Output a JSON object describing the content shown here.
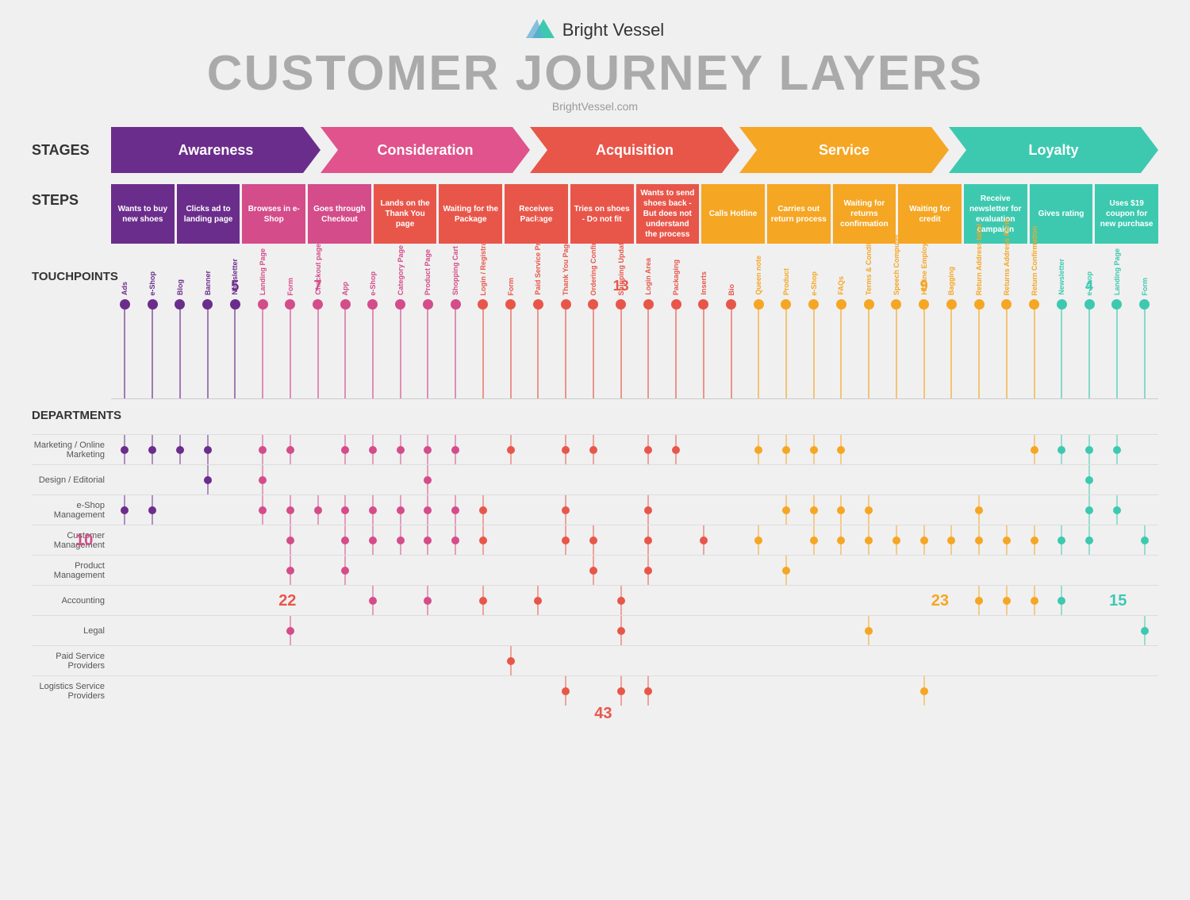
{
  "header": {
    "logo_text": "Bright Vessel",
    "title": "CUSTOMER JOURNEY LAYERS",
    "subtitle": "BrightVessel.com"
  },
  "stages_label": "STAGES",
  "stages": [
    {
      "label": "Awareness",
      "color": "#6b2d8b"
    },
    {
      "label": "Consideration",
      "color": "#e0538c"
    },
    {
      "label": "Acquisition",
      "color": "#e8564a"
    },
    {
      "label": "Service",
      "color": "#f5a623"
    },
    {
      "label": "Loyalty",
      "color": "#3dc9b0"
    }
  ],
  "steps_label": "STEPS",
  "steps": [
    {
      "text": "Wants to buy new shoes",
      "color": "#6b2d8b"
    },
    {
      "text": "Clicks ad to landing page",
      "color": "#6b2d8b"
    },
    {
      "text": "Browses in e-Shop",
      "color": "#d44c8a"
    },
    {
      "text": "Goes through Checkout",
      "color": "#d44c8a"
    },
    {
      "text": "Lands on the Thank You page",
      "color": "#e8564a"
    },
    {
      "text": "Waiting for the Package",
      "color": "#e8564a"
    },
    {
      "text": "Receives Package",
      "color": "#e8564a"
    },
    {
      "text": "Tries on shoes - Do not fit",
      "color": "#e8564a"
    },
    {
      "text": "Wants to send shoes back - But does not understand the process",
      "color": "#e8564a"
    },
    {
      "text": "Calls Hotline",
      "color": "#f5a623"
    },
    {
      "text": "Carries out return process",
      "color": "#f5a623"
    },
    {
      "text": "Waiting for returns confirmation",
      "color": "#f5a623"
    },
    {
      "text": "Waiting for credit",
      "color": "#f5a623"
    },
    {
      "text": "Receive newsletter for evaluation campaign",
      "color": "#3dc9b0"
    },
    {
      "text": "Gives rating",
      "color": "#3dc9b0"
    },
    {
      "text": "Uses $19 coupon for new purchase",
      "color": "#3dc9b0"
    }
  ],
  "touchpoints_label": "TOUCHPOINTS",
  "touchpoints": [
    {
      "label": "Ads",
      "color": "#6b2d8b",
      "count": null
    },
    {
      "label": "e-Shop",
      "color": "#6b2d8b",
      "count": null
    },
    {
      "label": "Blog",
      "color": "#6b2d8b",
      "count": null
    },
    {
      "label": "Banner",
      "color": "#6b2d8b",
      "count": null
    },
    {
      "label": "Newsletter",
      "color": "#6b2d8b",
      "count": "5"
    },
    {
      "label": "Landing Page",
      "color": "#d44c8a",
      "count": null
    },
    {
      "label": "Form",
      "color": "#d44c8a",
      "count": null
    },
    {
      "label": "Checkout page",
      "color": "#d44c8a",
      "count": "7"
    },
    {
      "label": "App",
      "color": "#d44c8a",
      "count": null
    },
    {
      "label": "e-Shop",
      "color": "#d44c8a",
      "count": null
    },
    {
      "label": "Category Page",
      "color": "#d44c8a",
      "count": null
    },
    {
      "label": "Product Page",
      "color": "#d44c8a",
      "count": null
    },
    {
      "label": "Shopping Cart",
      "color": "#d44c8a",
      "count": null
    },
    {
      "label": "Login / Registration",
      "color": "#e8564a",
      "count": null
    },
    {
      "label": "Form",
      "color": "#e8564a",
      "count": null
    },
    {
      "label": "Paid Service Providers",
      "color": "#e8564a",
      "count": null
    },
    {
      "label": "Thank You Page",
      "color": "#e8564a",
      "count": null
    },
    {
      "label": "Ordering Confirmation",
      "color": "#e8564a",
      "count": null
    },
    {
      "label": "Shipping Updates",
      "color": "#e8564a",
      "count": "13"
    },
    {
      "label": "Login Area",
      "color": "#e8564a",
      "count": null
    },
    {
      "label": "Packaging",
      "color": "#e8564a",
      "count": null
    },
    {
      "label": "Inserts",
      "color": "#e8564a",
      "count": null
    },
    {
      "label": "Bio",
      "color": "#e8564a",
      "count": null
    },
    {
      "label": "Queen note",
      "color": "#f5a623",
      "count": null
    },
    {
      "label": "Product",
      "color": "#f5a623",
      "count": null
    },
    {
      "label": "e-Shop",
      "color": "#f5a623",
      "count": null
    },
    {
      "label": "FAQs",
      "color": "#f5a623",
      "count": null
    },
    {
      "label": "Terms & Conditions",
      "color": "#f5a623",
      "count": null
    },
    {
      "label": "Speech Computer",
      "color": "#f5a623",
      "count": null
    },
    {
      "label": "Hotline Employee",
      "color": "#f5a623",
      "count": "9"
    },
    {
      "label": "Bagging",
      "color": "#f5a623",
      "count": null
    },
    {
      "label": "Return Address label",
      "color": "#f5a623",
      "count": null
    },
    {
      "label": "Returns Address Form",
      "color": "#f5a623",
      "count": null
    },
    {
      "label": "Return Confirmation",
      "color": "#f5a623",
      "count": null
    },
    {
      "label": "Newsletter",
      "color": "#3dc9b0",
      "count": null
    },
    {
      "label": "e-Shop",
      "color": "#3dc9b0",
      "count": "4"
    },
    {
      "label": "Landing Page",
      "color": "#3dc9b0",
      "count": null
    },
    {
      "label": "Form",
      "color": "#3dc9b0",
      "count": null
    }
  ],
  "departments_label": "DEPARTMENTS",
  "departments": [
    {
      "label": "Marketing / Online Marketing"
    },
    {
      "label": "Design / Editorial"
    },
    {
      "label": "e-Shop Management"
    },
    {
      "label": "Customer Management"
    },
    {
      "label": "Product Management"
    },
    {
      "label": "Accounting"
    },
    {
      "label": "Legal"
    },
    {
      "label": "Paid Service Providers"
    },
    {
      "label": "Logistics Service Providers"
    }
  ],
  "dept_dots": {
    "marketing": [
      1,
      1,
      1,
      1,
      0,
      1,
      1,
      0,
      1,
      1,
      1,
      1,
      1,
      0,
      1,
      0,
      1,
      1,
      0,
      1,
      1,
      0,
      0,
      1,
      1,
      1,
      1,
      0,
      0,
      0,
      0,
      0,
      0,
      1,
      1,
      1,
      1,
      0
    ],
    "design": [
      0,
      0,
      0,
      1,
      0,
      1,
      0,
      0,
      0,
      0,
      0,
      1,
      0,
      0,
      0,
      0,
      0,
      0,
      0,
      0,
      0,
      0,
      0,
      0,
      0,
      0,
      0,
      0,
      0,
      0,
      0,
      0,
      0,
      0,
      0,
      1,
      0,
      0
    ],
    "eshop": [
      1,
      1,
      0,
      0,
      0,
      1,
      1,
      1,
      1,
      1,
      1,
      1,
      1,
      1,
      0,
      0,
      1,
      0,
      0,
      1,
      0,
      0,
      0,
      0,
      1,
      1,
      1,
      1,
      0,
      0,
      0,
      1,
      0,
      0,
      0,
      1,
      1,
      0
    ],
    "customer": [
      0,
      0,
      0,
      0,
      0,
      0,
      1,
      0,
      1,
      1,
      1,
      1,
      1,
      1,
      0,
      0,
      1,
      1,
      0,
      1,
      0,
      1,
      0,
      1,
      0,
      1,
      1,
      1,
      1,
      1,
      1,
      1,
      1,
      1,
      1,
      1,
      0,
      1
    ],
    "product": [
      0,
      0,
      0,
      0,
      0,
      0,
      1,
      0,
      1,
      0,
      0,
      0,
      0,
      0,
      0,
      0,
      0,
      1,
      0,
      1,
      0,
      0,
      0,
      0,
      1,
      0,
      0,
      0,
      0,
      0,
      0,
      0,
      0,
      0,
      0,
      0,
      0,
      0
    ],
    "accounting": [
      0,
      0,
      0,
      0,
      0,
      0,
      0,
      0,
      0,
      1,
      0,
      1,
      0,
      1,
      0,
      1,
      0,
      0,
      1,
      0,
      0,
      0,
      0,
      0,
      0,
      0,
      0,
      0,
      0,
      0,
      0,
      1,
      1,
      1,
      1,
      0,
      0,
      0
    ],
    "legal": [
      0,
      0,
      0,
      0,
      0,
      0,
      1,
      0,
      0,
      0,
      0,
      0,
      0,
      0,
      0,
      0,
      0,
      0,
      1,
      0,
      0,
      0,
      0,
      0,
      0,
      0,
      0,
      1,
      0,
      0,
      0,
      0,
      0,
      0,
      0,
      0,
      0,
      1
    ],
    "paid": [
      0,
      0,
      0,
      0,
      0,
      0,
      0,
      0,
      0,
      0,
      0,
      0,
      0,
      0,
      1,
      0,
      0,
      0,
      0,
      0,
      0,
      0,
      0,
      0,
      0,
      0,
      0,
      0,
      0,
      0,
      0,
      0,
      0,
      0,
      0,
      0,
      0,
      0
    ],
    "logistics": [
      0,
      0,
      0,
      0,
      0,
      0,
      0,
      0,
      0,
      0,
      0,
      0,
      0,
      0,
      0,
      0,
      1,
      0,
      1,
      1,
      0,
      0,
      0,
      0,
      0,
      0,
      0,
      0,
      0,
      1,
      0,
      0,
      0,
      0,
      0,
      0,
      0,
      0
    ]
  },
  "counts": {
    "awareness": "5",
    "consideration_tp": "7",
    "acquisition_tp": "13",
    "service_tp": "9",
    "loyalty_tp": "4",
    "customer_mgmt": "10",
    "accounting_awareness": "22",
    "accounting_service": "23",
    "accounting_loyalty": "15",
    "logistics_bottom": "43"
  }
}
